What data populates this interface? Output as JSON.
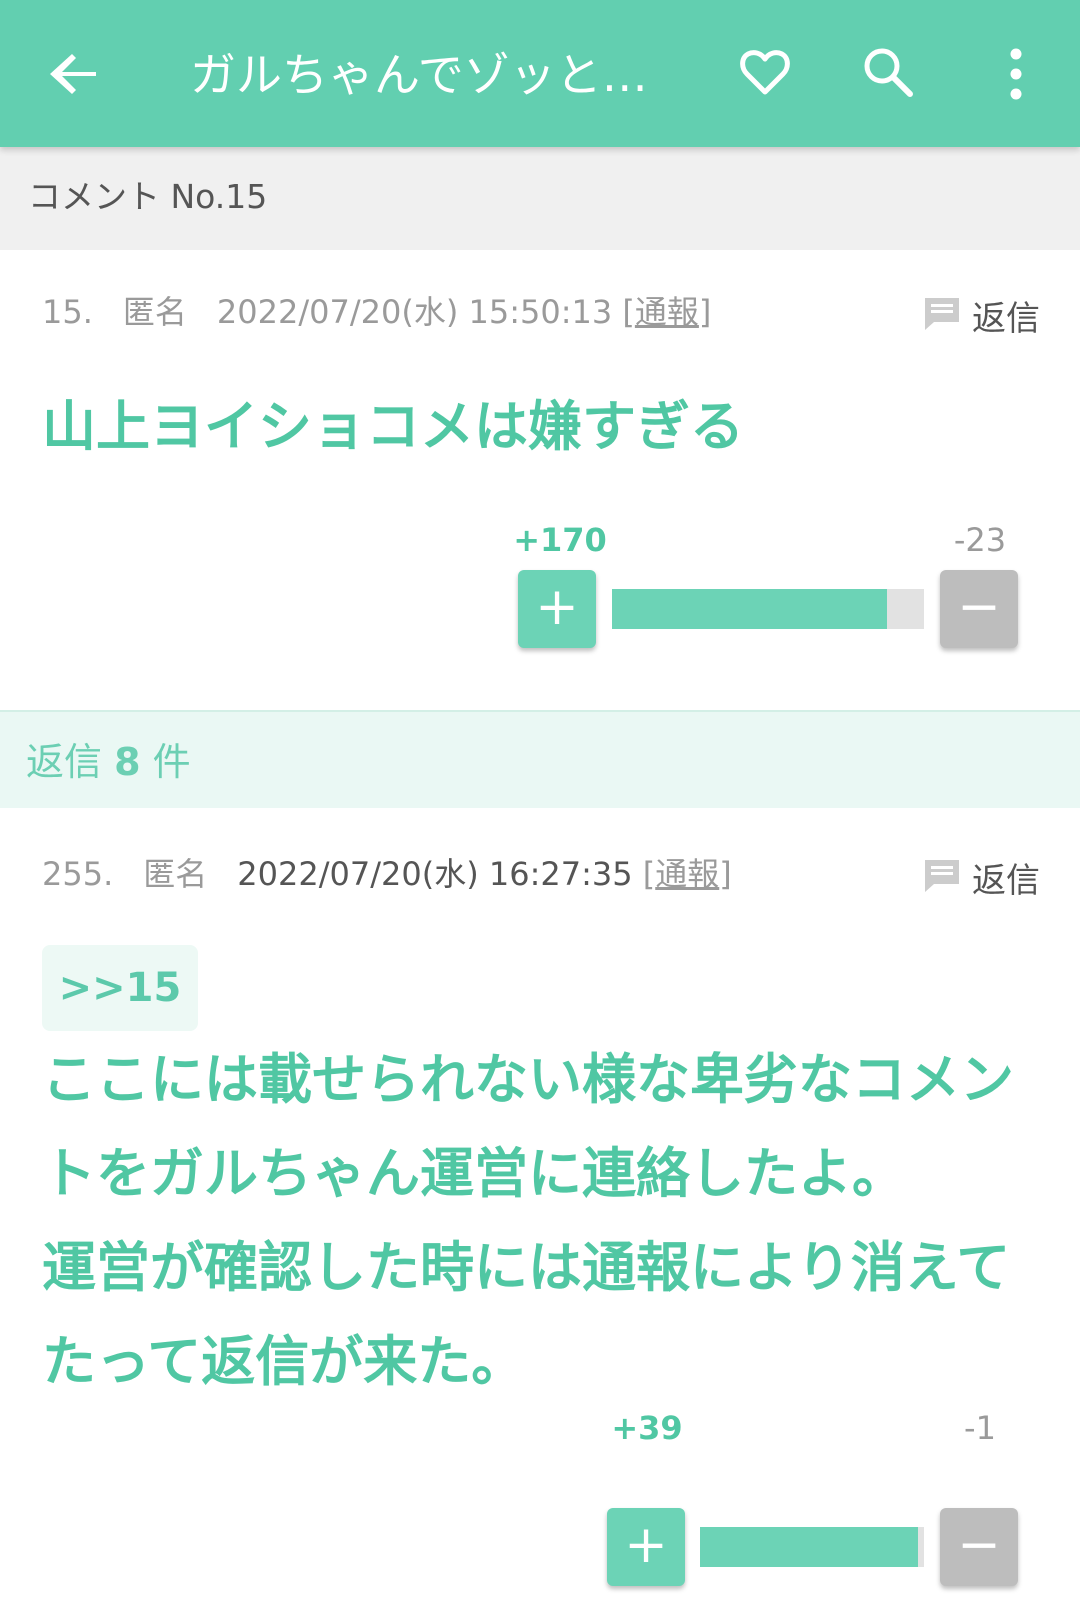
{
  "appbar": {
    "title": "ガルちゃんでゾッと…",
    "back_icon": "arrow-left-icon",
    "favorite_icon": "heart-outline-icon",
    "search_icon": "search-icon",
    "menu_icon": "more-vert-icon",
    "color": "#62cfb0"
  },
  "section": {
    "title": "コメント No.15"
  },
  "main_comment": {
    "number": "15.",
    "author": "匿名",
    "date": "2022/07/20(水) 15:50:13",
    "report_label": "通報",
    "reply_label": "返信",
    "body": "山上ヨイショコメは嫌すぎる",
    "plus_count": "+170",
    "minus_count": "-23",
    "plus_symbol": "+",
    "minus_symbol": "−",
    "plus_ratio": 0.881
  },
  "replies": {
    "label_prefix": "返信",
    "count": "8",
    "label_suffix": "件"
  },
  "reply_comment": {
    "number": "255.",
    "author": "匿名",
    "date": "2022/07/20(水) 16:27:35",
    "report_label": "通報",
    "reply_label": "返信",
    "anchor": ">>15",
    "body_lines": [
      "ここには載せられない様な卑劣なコメン",
      "トをガルちゃん運営に連絡したよ。",
      "運営が確認した時には通報により消えて",
      "たって返信が来た。"
    ],
    "plus_count": "+39",
    "minus_count": "-1",
    "plus_symbol": "+",
    "minus_symbol": "−",
    "plus_ratio": 0.975
  }
}
